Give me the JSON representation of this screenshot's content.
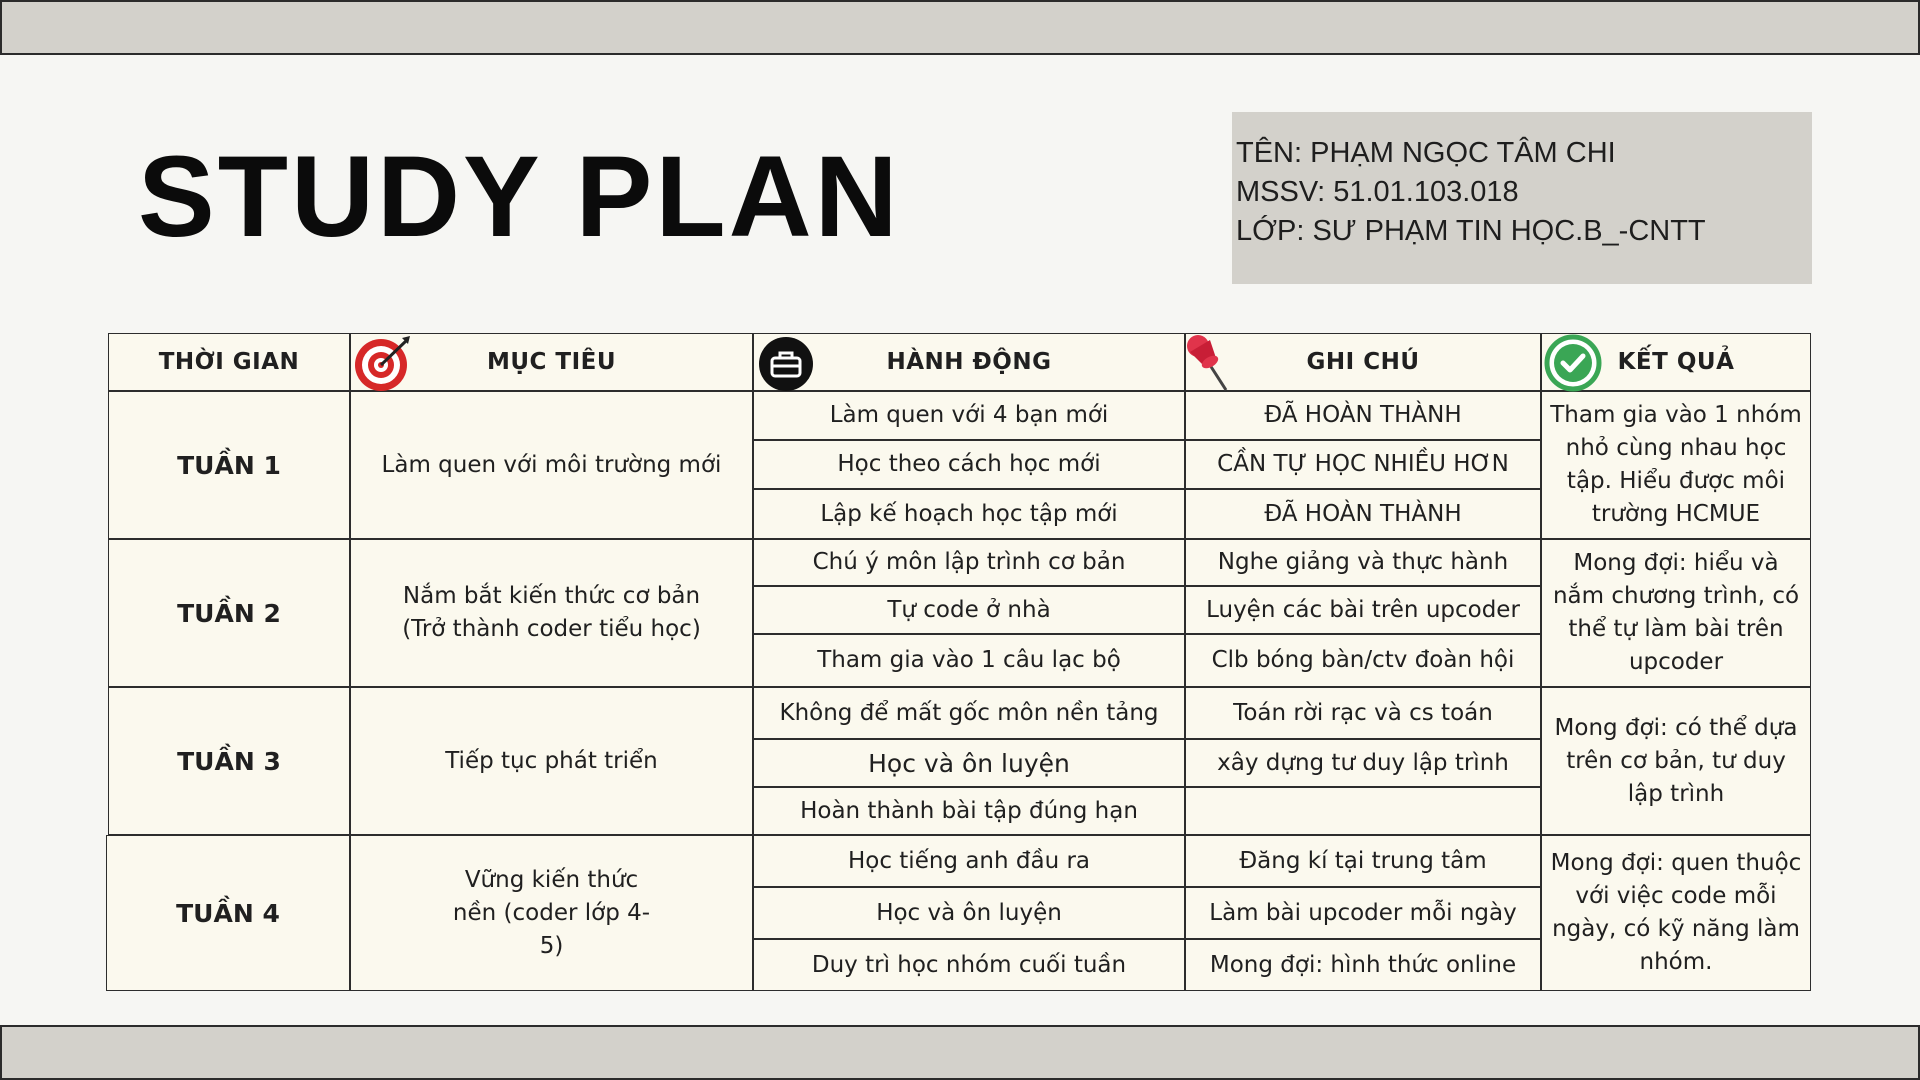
{
  "title": "STUDY PLAN",
  "info": {
    "name": "TÊN: PHẠM NGỌC TÂM CHI",
    "mssv": "MSSV: 51.01.103.018",
    "class": "LỚP: SƯ PHẠM TIN HỌC.B_-CNTT"
  },
  "headers": {
    "time": "THỜI GIAN",
    "goal": "MỤC TIÊU",
    "action": "HÀNH ĐỘNG",
    "note": "GHI CHÚ",
    "result": "KẾT QUẢ"
  },
  "icons": {
    "goal": "target-icon",
    "action": "briefcase-icon",
    "note": "pushpin-icon",
    "result": "check-circle-icon"
  },
  "colors": {
    "band": "#d3d1cb",
    "cell": "#fbf9ee",
    "target": "#d62828",
    "check": "#3aa655"
  },
  "weeks": [
    {
      "label": "TUẦN 1",
      "goal": "Làm quen với môi trường mới",
      "actions": [
        "Làm quen với 4 bạn mới",
        "Học theo cách học mới",
        "Lập kế hoạch học tập mới"
      ],
      "notes": [
        "ĐÃ HOÀN THÀNH",
        "CẦN TỰ HỌC NHIỀU HƠN",
        "ĐÃ HOÀN THÀNH"
      ],
      "result": "Tham gia vào 1 nhóm nhỏ cùng nhau học tập. Hiểu được môi trường HCMUE"
    },
    {
      "label": "TUẦN 2",
      "goal": "Nắm bắt kiến thức cơ bản (Trở thành coder tiểu học)",
      "actions": [
        "Chú ý môn lập trình cơ bản",
        "Tự code ở nhà",
        "Tham gia vào 1 câu lạc bộ"
      ],
      "notes": [
        "Nghe giảng và thực hành",
        "Luyện các bài trên upcoder",
        "Clb bóng bàn/ctv đoàn hội"
      ],
      "result": "Mong đợi: hiểu và nắm chương trình, có thể tự làm bài trên upcoder"
    },
    {
      "label": "TUẦN 3",
      "goal": "Tiếp tục phát triển",
      "actions": [
        "Không để mất gốc môn nền tảng",
        "Học và ôn luyện",
        "Hoàn thành bài tập đúng hạn"
      ],
      "notes": [
        "Toán rời rạc và cs toán",
        "xây dựng tư duy lập trình",
        ""
      ],
      "result": "Mong đợi: có thể dựa trên cơ bản, tư duy lập trình"
    },
    {
      "label": "TUẦN 4",
      "goal": "Vững kiến thức nền (coder lớp 4-5)",
      "actions": [
        "Học tiếng anh đầu ra",
        "Học và ôn luyện",
        "Duy trì học nhóm cuối tuần"
      ],
      "notes": [
        "Đăng kí tại trung tâm",
        "Làm bài upcoder mỗi ngày",
        "Mong đợi: hình thức online"
      ],
      "result": "Mong đợi: quen thuộc với việc code mỗi ngày, có kỹ năng làm nhóm."
    }
  ]
}
